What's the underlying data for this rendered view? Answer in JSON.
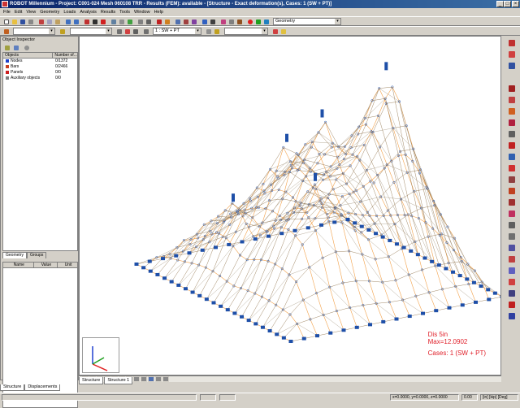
{
  "window": {
    "title": "ROBOT Millennium - Project: C001-024 Mesh 060108 TRR - Results (FEM): available - [Structure - Exact deformation(s), Cases: 1 (SW + PT)]",
    "controls": [
      "_",
      "□",
      "×"
    ]
  },
  "menu": [
    "File",
    "Edit",
    "View",
    "Geometry",
    "Loads",
    "Analysis",
    "Results",
    "Tools",
    "Window",
    "Help"
  ],
  "toolbar": {
    "layout_combo": "Geometry",
    "case_combo": "1 : SW + PT",
    "combo_blank_1": "",
    "combo_blank_2": "",
    "combo_blank_3": ""
  },
  "inspector": {
    "title": "Object Inspector",
    "columns": [
      "Objects",
      "Number of..."
    ],
    "rows": [
      {
        "name": "Nodes",
        "value": "0/1372",
        "color": "#1e40c8"
      },
      {
        "name": "Bars",
        "value": "0/2466",
        "color": "#c84020"
      },
      {
        "name": "Panels",
        "value": "0/0",
        "color": "#cc2020"
      },
      {
        "name": "Auxiliary objects",
        "value": "0/0",
        "color": "#808080"
      }
    ],
    "tabs": [
      "Geometry",
      "Groups"
    ],
    "prop_columns": [
      "Name",
      "Value",
      "Unit"
    ]
  },
  "bottom_tabs": [
    "Structure",
    "Displacements"
  ],
  "view_tabs": [
    "Structure",
    "Structure 1"
  ],
  "legend": {
    "line1": "Dis   5in",
    "line2": "Max=12.0902",
    "line3": "Cases: 1 (SW + PT)",
    "color": "#e0202a"
  },
  "status": {
    "coords": "x=0.0000, y=0.0000, z=0.0000",
    "angle": "0.00",
    "units": "[in] [kip] [Deg]"
  },
  "colors": {
    "mesh_blue": "#1e4fa8",
    "mesh_orange": "#f0902a",
    "titlebar": "#0a246a"
  }
}
